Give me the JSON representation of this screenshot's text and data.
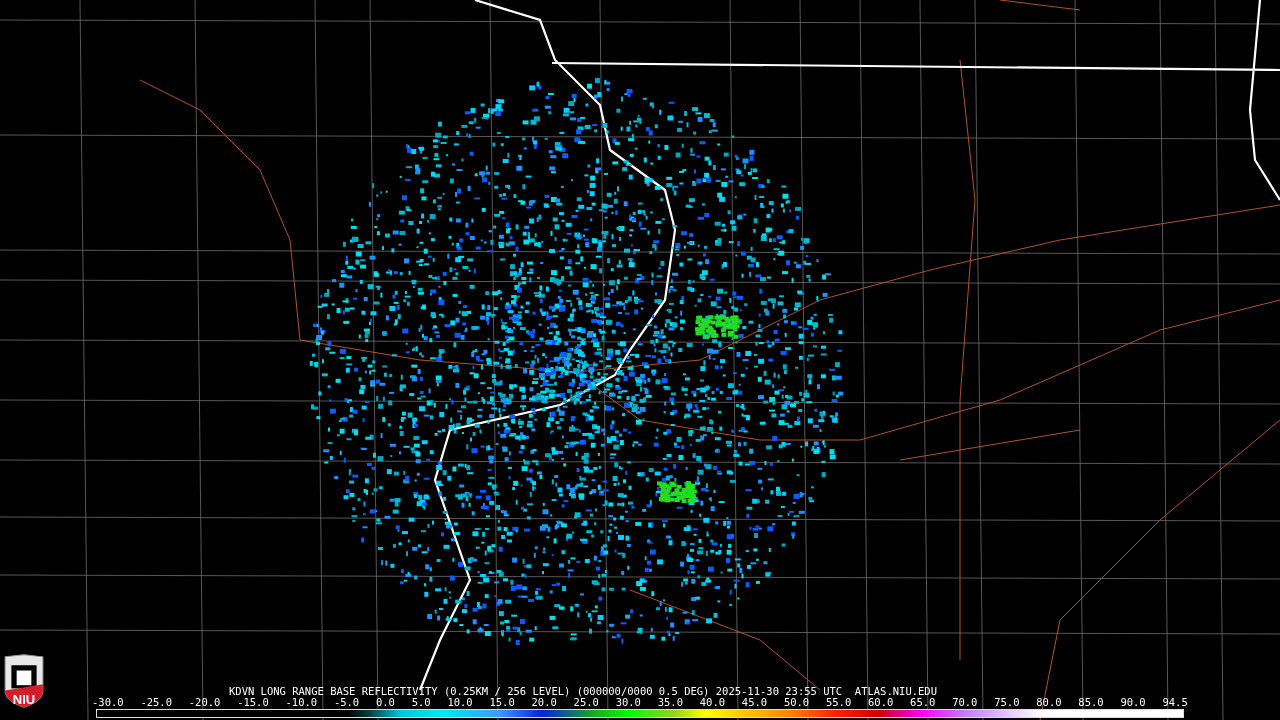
{
  "logo": {
    "text": "NIU"
  },
  "caption": "KDVN LONG RANGE BASE REFLECTIVITY (0.25KM / 256 LEVEL) (000000/0000 0.5 DEG) 2025-11-30 23:55 UTC  ATLAS.NIU.EDU",
  "legend": {
    "ticks": [
      "-30.0",
      "-25.0",
      "-20.0",
      "-15.0",
      "-10.0",
      "-5.0",
      "0.0",
      "5.0",
      "10.0",
      "15.0",
      "20.0",
      "25.0",
      "30.0",
      "35.0",
      "40.0",
      "45.0",
      "50.0",
      "55.0",
      "60.0",
      "65.0",
      "70.0",
      "75.0",
      "80.0",
      "85.0",
      "90.0",
      "94.5"
    ]
  }
}
